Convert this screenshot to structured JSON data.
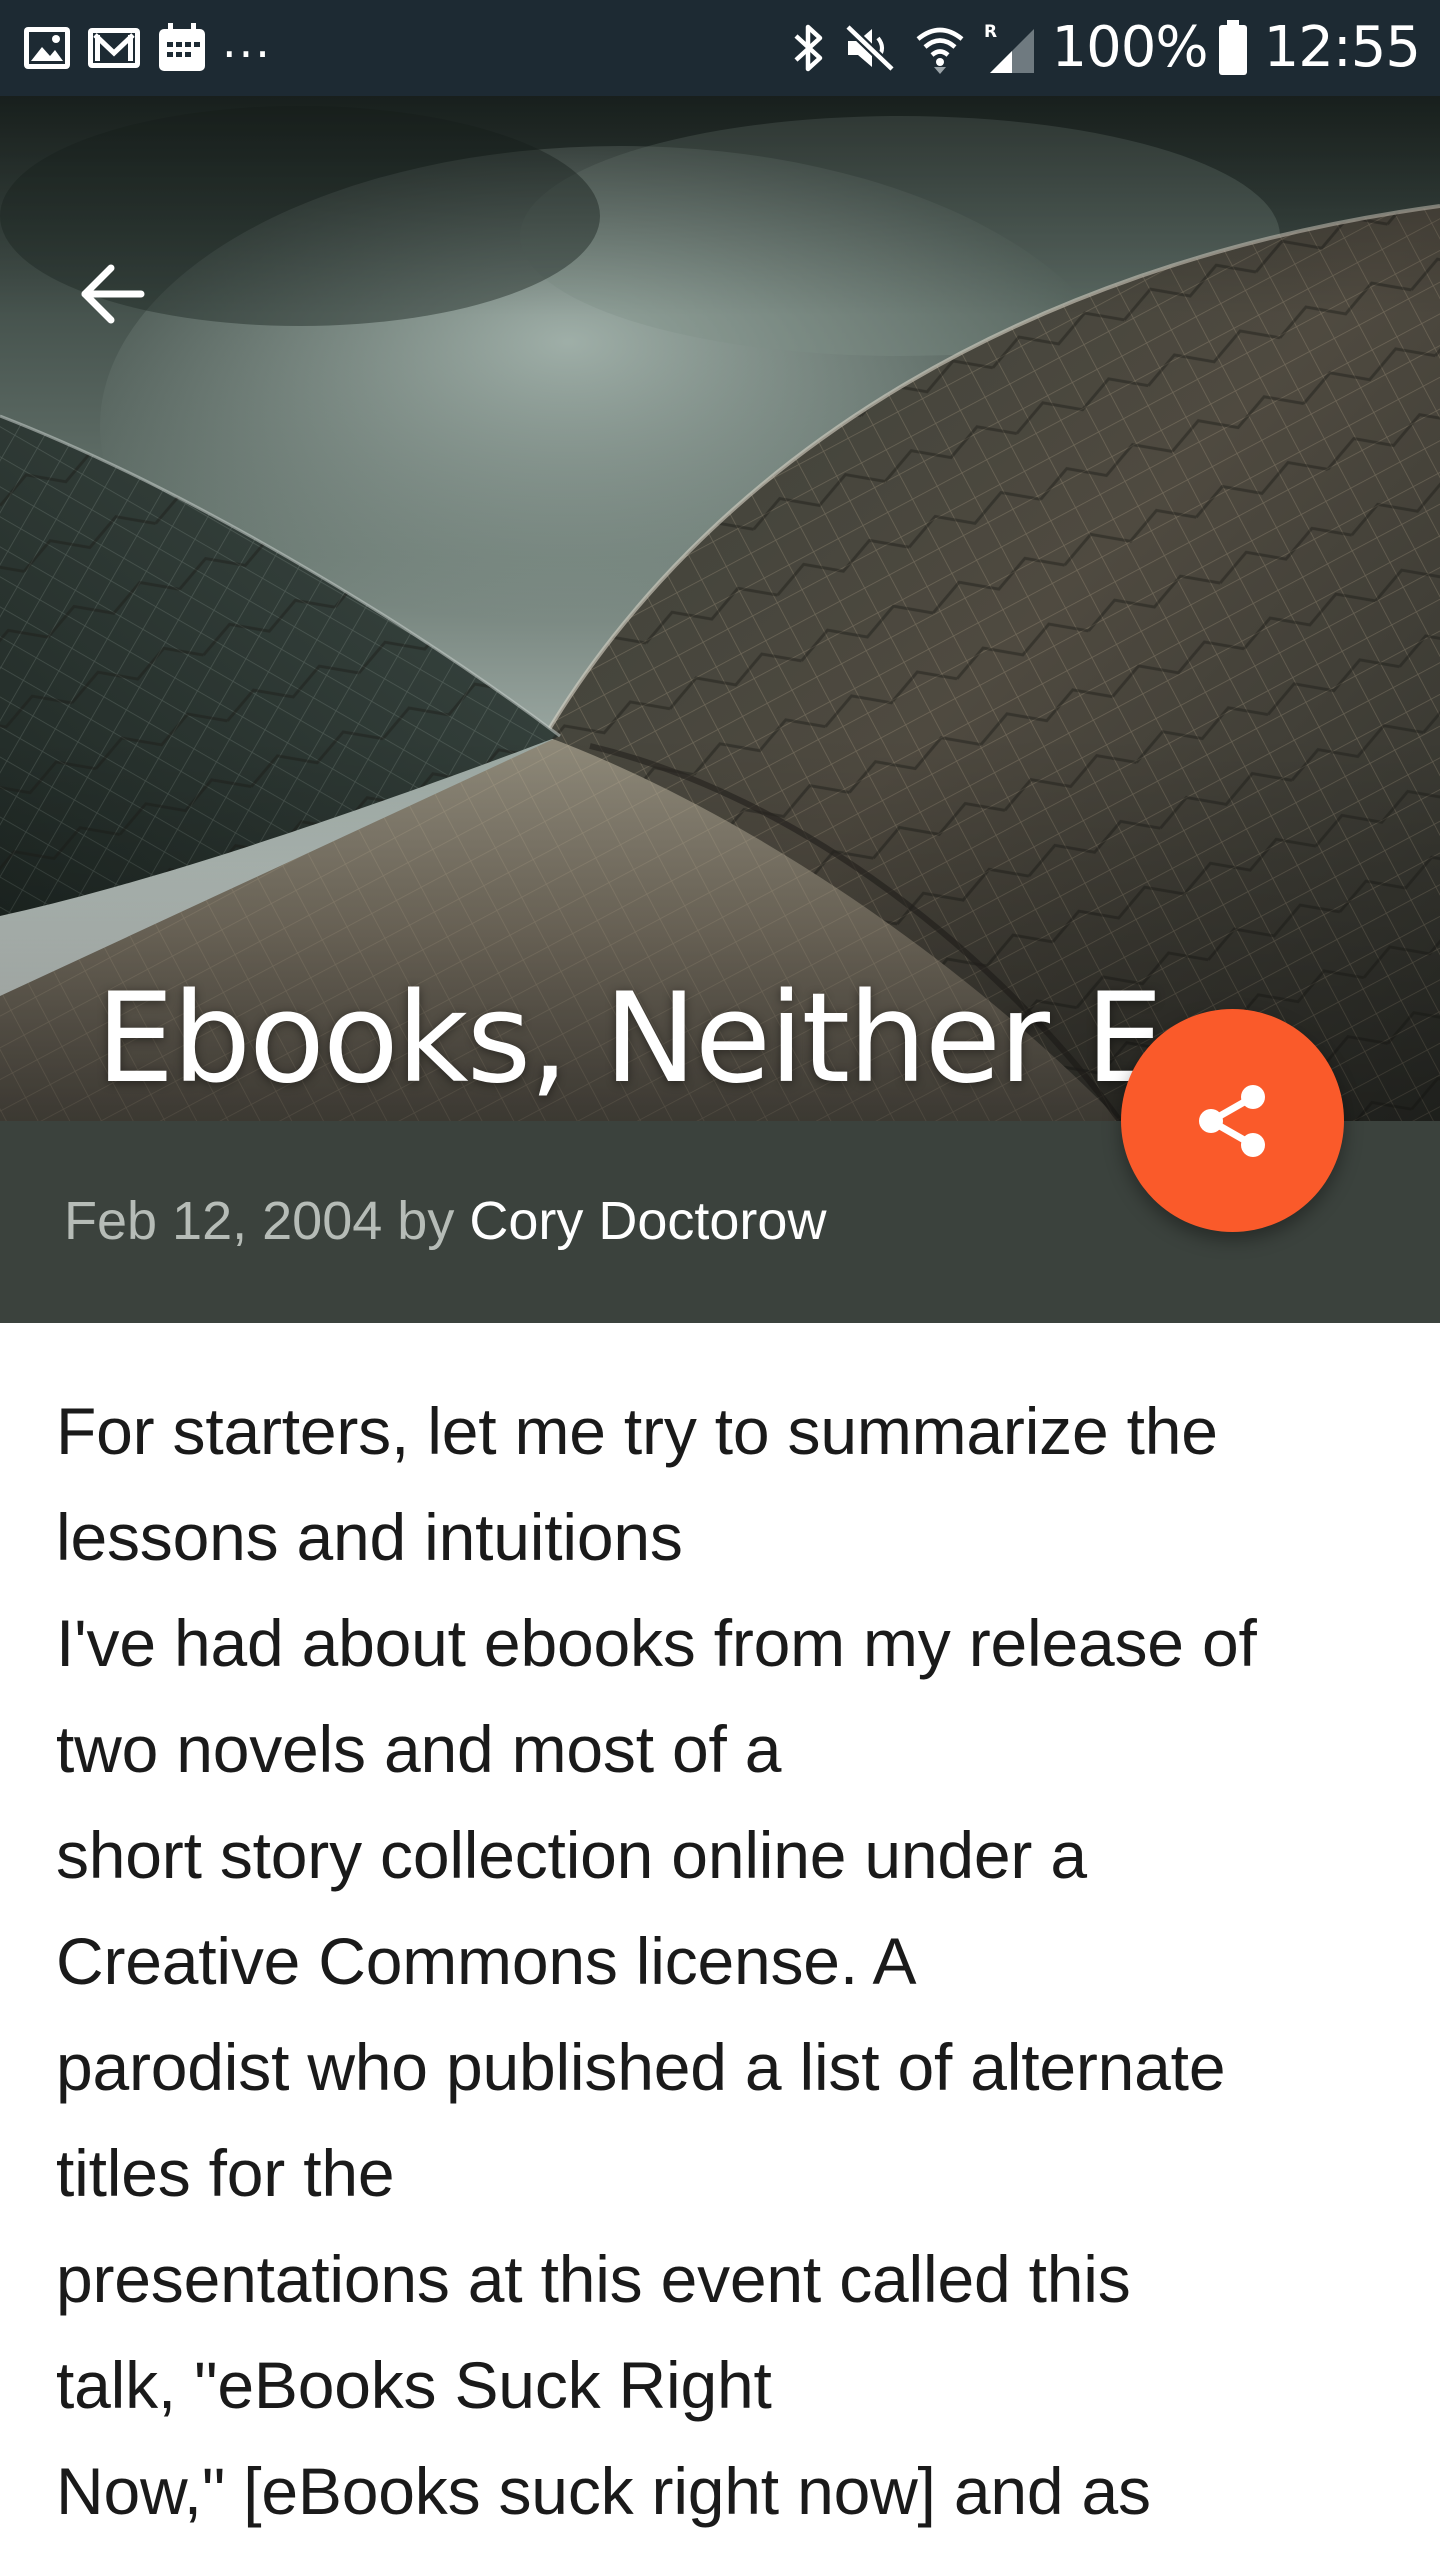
{
  "status_bar": {
    "left_icons": [
      "gallery-icon",
      "mail-icon",
      "calendar-icon"
    ],
    "more_indicator": "...",
    "right_icons": [
      "bluetooth-icon",
      "mute-icon",
      "wifi-icon",
      "signal-roaming-icon"
    ],
    "battery_percent": "100%",
    "time": "12:55"
  },
  "hero": {
    "back_icon": "arrow-back-icon",
    "title": "Ebooks, Neither E,..."
  },
  "meta": {
    "date": "Feb 12, 2004",
    "by": "by",
    "author": "Cory Doctorow"
  },
  "fab": {
    "icon": "share-icon",
    "color": "#fa5a2a"
  },
  "article": {
    "lines": [
      "For starters, let me try to summarize the",
      "lessons and intuitions",
      "I've had about ebooks from my release of",
      "two novels and most of a",
      "short story collection online under a",
      "Creative Commons license. A",
      "parodist who published a list of alternate",
      "titles for the",
      "presentations at this event called this",
      "talk, \"eBooks Suck Right",
      "Now,\" [eBooks suck right now] and as"
    ]
  },
  "colors": {
    "status_bar": "#1d2a33",
    "meta_bar": "#3b423d",
    "accent": "#fa5a2a",
    "body_text": "#1a1a1a"
  }
}
